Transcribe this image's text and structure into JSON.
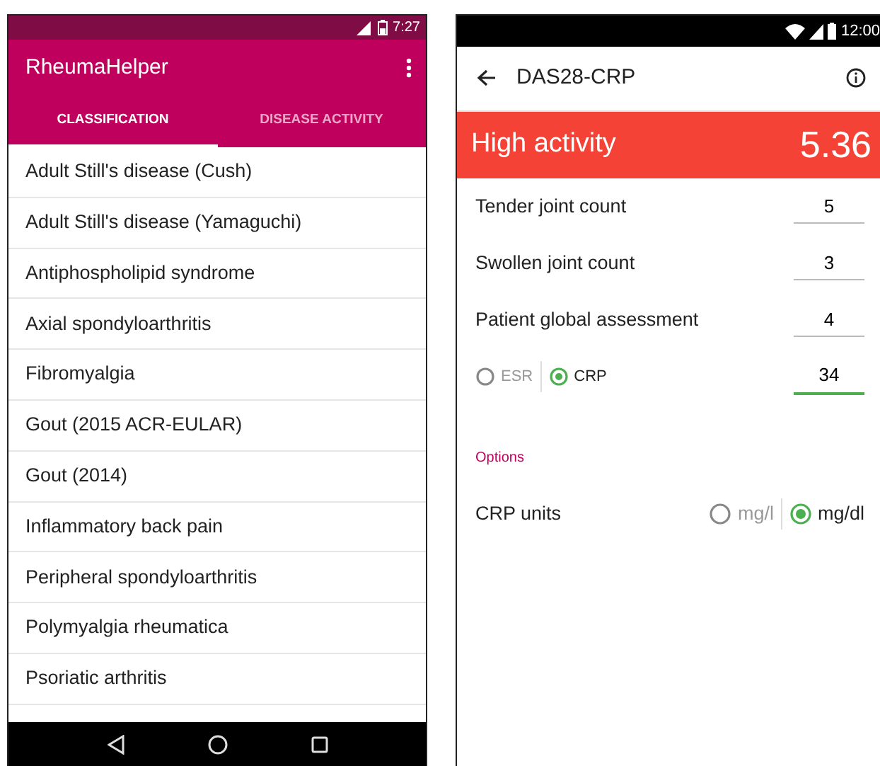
{
  "left_phone": {
    "status_bar": {
      "time": "7:27"
    },
    "app_bar": {
      "title": "RheumaHelper"
    },
    "tabs": [
      {
        "label": "CLASSIFICATION",
        "selected": true
      },
      {
        "label": "DISEASE ACTIVITY",
        "selected": false
      }
    ],
    "list": [
      "Adult Still's disease (Cush)",
      "Adult Still's disease (Yamaguchi)",
      "Antiphospholipid syndrome",
      "Axial spondyloarthritis",
      "Fibromyalgia",
      "Gout (2015 ACR-EULAR)",
      "Gout (2014)",
      "Inflammatory back pain",
      "Peripheral spondyloarthritis",
      "Polymyalgia rheumatica",
      "Psoriatic arthritis"
    ]
  },
  "right_phone": {
    "status_bar": {
      "time": "12:00"
    },
    "toolbar": {
      "title": "DAS28-CRP"
    },
    "result": {
      "label": "High activity",
      "score": "5.36",
      "color": "#f44336"
    },
    "inputs": [
      {
        "label": "Tender joint count",
        "value": "5",
        "focused": false
      },
      {
        "label": "Swollen joint count",
        "value": "3",
        "focused": false
      },
      {
        "label": "Patient global assessment",
        "value": "4",
        "focused": false
      }
    ],
    "marker_row": {
      "options": [
        {
          "label": "ESR",
          "selected": false
        },
        {
          "label": "CRP",
          "selected": true
        }
      ],
      "value": "34",
      "focused": true
    },
    "options_header": "Options",
    "units": {
      "label": "CRP units",
      "options": [
        {
          "label": "mg/l",
          "selected": false
        },
        {
          "label": "mg/dl",
          "selected": true
        }
      ]
    }
  }
}
